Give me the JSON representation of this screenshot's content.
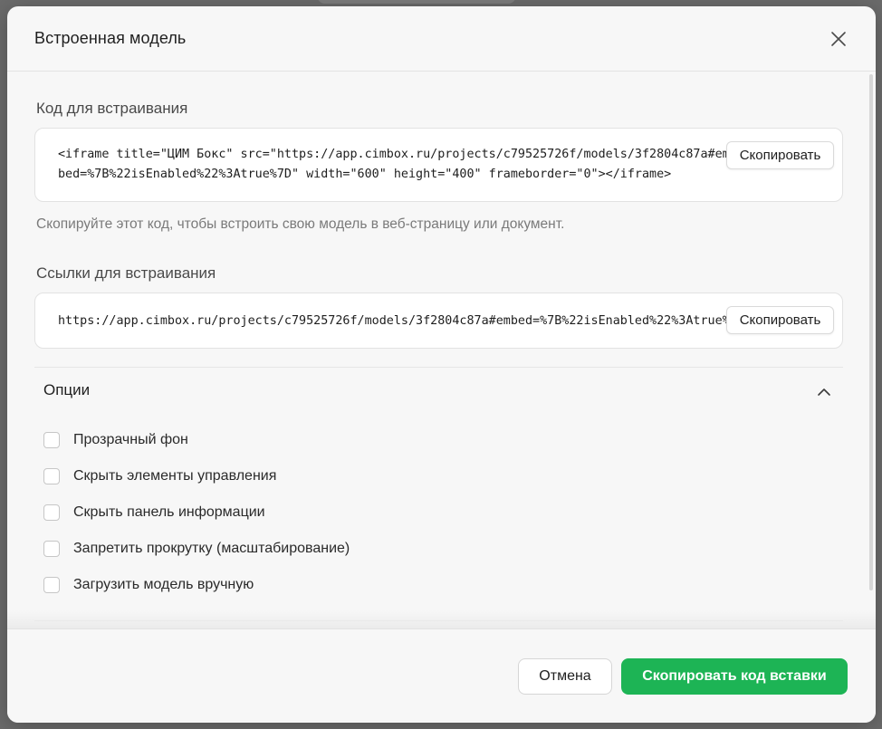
{
  "dialog": {
    "title": "Встроенная модель"
  },
  "embed_code": {
    "label": "Код для встраивания",
    "line1": "<iframe title=\"ЦИМ Бокс\" src=\"https://app.cimbox.ru/projects/c79525726f/models/3f2804c87a#embed",
    "line2": "bed=%7B%22isEnabled%22%3Atrue%7D\" width=\"600\" height=\"400\" frameborder=\"0\"></iframe>",
    "copy_label": "Скопировать",
    "hint": "Скопируйте этот код, чтобы встроить свою модель в веб-страницу или документ."
  },
  "embed_link": {
    "label": "Ссылки для встраивания",
    "url": "https://app.cimbox.ru/projects/c79525726f/models/3f2804c87a#embed=%7B%22isEnabled%22%3Atrue%7D",
    "copy_label": "Скопировать"
  },
  "options": {
    "title": "Опции",
    "expanded": true,
    "items": [
      {
        "label": "Прозрачный фон",
        "checked": false
      },
      {
        "label": "Скрыть элементы управления",
        "checked": false
      },
      {
        "label": "Скрыть панель информации",
        "checked": false
      },
      {
        "label": "Запретить прокрутку (масштабирование)",
        "checked": false
      },
      {
        "label": "Загрузить модель вручную",
        "checked": false
      }
    ]
  },
  "footer": {
    "cancel_label": "Отмена",
    "primary_label": "Скопировать код вставки"
  },
  "colors": {
    "primary": "#1db455",
    "overlay": "#6b6b6b",
    "surface": "#f7f7f7"
  },
  "icons": {
    "close": "close-icon",
    "collapse": "chevron-up-icon"
  }
}
